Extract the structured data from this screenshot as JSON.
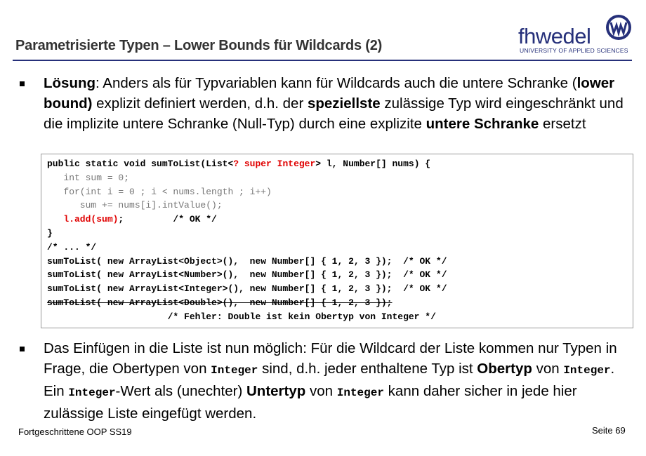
{
  "header": {
    "title": "Parametrisierte Typen – Lower Bounds für Wildcards (2)",
    "logo_text": "fhwedel",
    "logo_subtitle": "UNIVERSITY OF APPLIED SCIENCES",
    "brand_color": "#26307a"
  },
  "bullet1": {
    "t1": "Lösung",
    "t2": ": Anders als für Typvariablen kann für Wildcards auch die untere Schranke (",
    "t3": "lower bound)",
    "t4": " explizit definiert werden, d.h. der ",
    "t5": "speziellste",
    "t6": " zulässige Typ wird eingeschränkt und die implizite untere Schranke (Null-Typ) durch eine explizite ",
    "t7": "untere Schranke",
    "t8": " ersetzt"
  },
  "code": {
    "l1a": "public static void sumToList(List<",
    "l1b": "? super Integer",
    "l1c": "> l, Number[] nums) {",
    "l2": "   int sum = 0;",
    "l3": "   for(int i = 0 ; i < nums.length ; i++)",
    "l4": "      sum += nums[i].intValue();",
    "l5a": "   ",
    "l5b": "l.add(sum)",
    "l5c": ";         /* OK */",
    "l6": "}",
    "l7": "/* ... */",
    "l8": "sumToList( new ArrayList<Object>(),  new Number[] { 1, 2, 3 });  /* OK */",
    "l9": "sumToList( new ArrayList<Number>(),  new Number[] { 1, 2, 3 });  /* OK */",
    "l10": "sumToList( new ArrayList<Integer>(), new Number[] { 1, 2, 3 });  /* OK */",
    "l11": "sumToList( new ArrayList<Double>(),  new Number[] { 1, 2, 3 });",
    "l12": "                      /* Fehler: Double ist kein Obertyp von Integer */"
  },
  "bullet2": {
    "t1": "Das Einfügen in die Liste ist nun möglich: Für die Wildcard der Liste kommen nur Typen in Frage, die Obertypen von ",
    "c1": "Integer",
    "t2": " sind, d.h. jeder enthaltene Typ ist ",
    "t3": "Obertyp",
    "t4": " von ",
    "c2": "Integer",
    "t5": ". Ein ",
    "c3": "Integer",
    "t6": "-Wert als (unechter) ",
    "t7": "Untertyp",
    "t8": " von ",
    "c4": "Integer",
    "t9": " kann daher sicher in jede hier zulässige Liste eingefügt werden."
  },
  "footer": {
    "left": "Fortgeschrittene OOP SS19",
    "right": "Seite 69"
  }
}
